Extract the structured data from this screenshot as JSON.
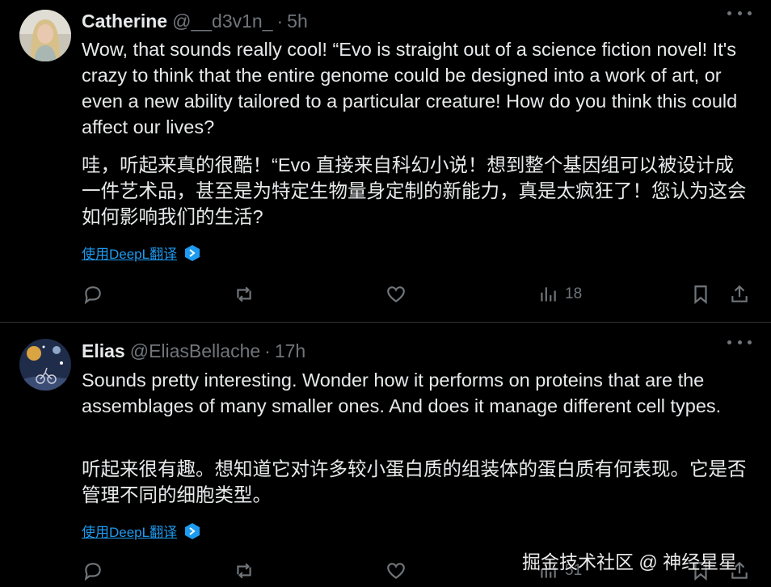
{
  "tweets": [
    {
      "name": "Catherine",
      "handle": "@__d3v1n_",
      "separator": "·",
      "time": "5h",
      "text_en": "Wow, that sounds really cool! “Evo is straight out of a science fiction novel! It's crazy to think that the entire genome could be designed into a work of art, or even a new ability tailored to a particular creature! How do you think this could affect our lives?",
      "text_zh": "哇，听起来真的很酷！“Evo 直接来自科幻小说！想到整个基因组可以被设计成一件艺术品，甚至是为特定生物量身定制的新能力，真是太疯狂了！您认为这会如何影响我们的生活?",
      "translate_label": "使用DeepL翻译",
      "views": "18"
    },
    {
      "name": "Elias",
      "handle": "@EliasBellache",
      "separator": "·",
      "time": "17h",
      "text_en": "Sounds pretty interesting. Wonder how it performs on proteins that are the assemblages of many smaller ones. And does it manage different cell types.",
      "text_zh": "听起来很有趣。想知道它对许多较小蛋白质的组装体的蛋白质有何表现。它是否管理不同的细胞类型。",
      "translate_label": "使用DeepL翻译",
      "views": "51"
    }
  ],
  "watermark": "掘金技术社区 @ 神经星星",
  "colors": {
    "background": "#000000",
    "text": "#e7e9ea",
    "muted": "#71767b",
    "link": "#1d9bf0",
    "divider": "#2f3336"
  },
  "icons": [
    "more-icon",
    "reply-icon",
    "retweet-icon",
    "like-icon",
    "views-icon",
    "bookmark-icon",
    "share-icon",
    "deepl-icon"
  ]
}
